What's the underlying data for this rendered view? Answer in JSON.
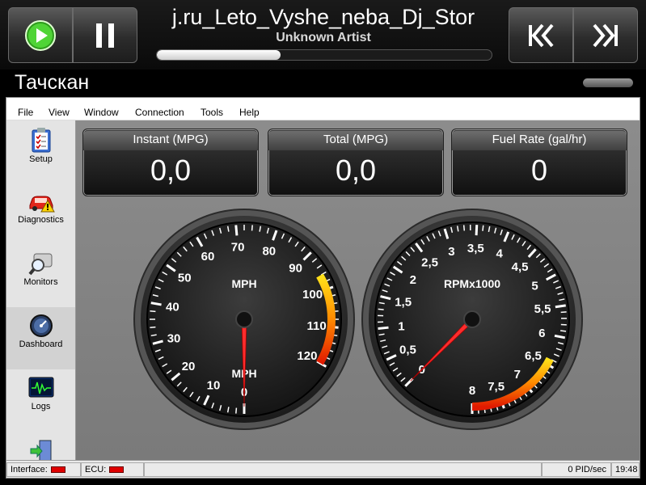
{
  "player": {
    "track_title": "j.ru_Leto_Vyshe_neba_Dj_Stor",
    "artist": "Unknown Artist",
    "progress_fraction": 0.37,
    "play_icon": "play-icon",
    "pause_icon": "pause-icon",
    "prev_icon": "previous-track-icon",
    "next_icon": "next-track-icon",
    "accent_color": "#3fbf2a"
  },
  "app": {
    "title": "Тачскан"
  },
  "menu": [
    "File",
    "View",
    "Window",
    "Connection",
    "Tools",
    "Help"
  ],
  "sidebar": {
    "items": [
      {
        "label": "Setup",
        "icon": "setup-clipboard-icon"
      },
      {
        "label": "Diagnostics",
        "icon": "car-warning-icon"
      },
      {
        "label": "Monitors",
        "icon": "magnifier-icon"
      },
      {
        "label": "Dashboard",
        "icon": "gauge-icon",
        "active": true
      },
      {
        "label": "Logs",
        "icon": "waveform-monitor-icon"
      },
      {
        "label": "",
        "icon": "exit-door-icon"
      }
    ]
  },
  "readouts": [
    {
      "label": "Instant (MPG)",
      "value": "0,0"
    },
    {
      "label": "Total (MPG)",
      "value": "0,0"
    },
    {
      "label": "Fuel Rate (gal/hr)",
      "value": "0"
    }
  ],
  "gauges": {
    "speed": {
      "title": "MPH",
      "unit_label": "MPH",
      "ticks": [
        "0",
        "10",
        "20",
        "30",
        "40",
        "50",
        "60",
        "70",
        "80",
        "90",
        "100",
        "110",
        "120"
      ],
      "value": 0
    },
    "rpm": {
      "title": "RPMx1000",
      "ticks": [
        "0",
        "0,5",
        "1",
        "1,5",
        "2",
        "2,5",
        "3",
        "3,5",
        "4",
        "4,5",
        "5",
        "5,5",
        "6",
        "6,5",
        "7",
        "7,5",
        "8"
      ],
      "value": 0
    }
  },
  "status": {
    "interface_label": "Interface:",
    "ecu_label": "ECU:",
    "pid_rate": "0 PID/sec",
    "clock": "19:48",
    "led_color": "#e00000"
  }
}
